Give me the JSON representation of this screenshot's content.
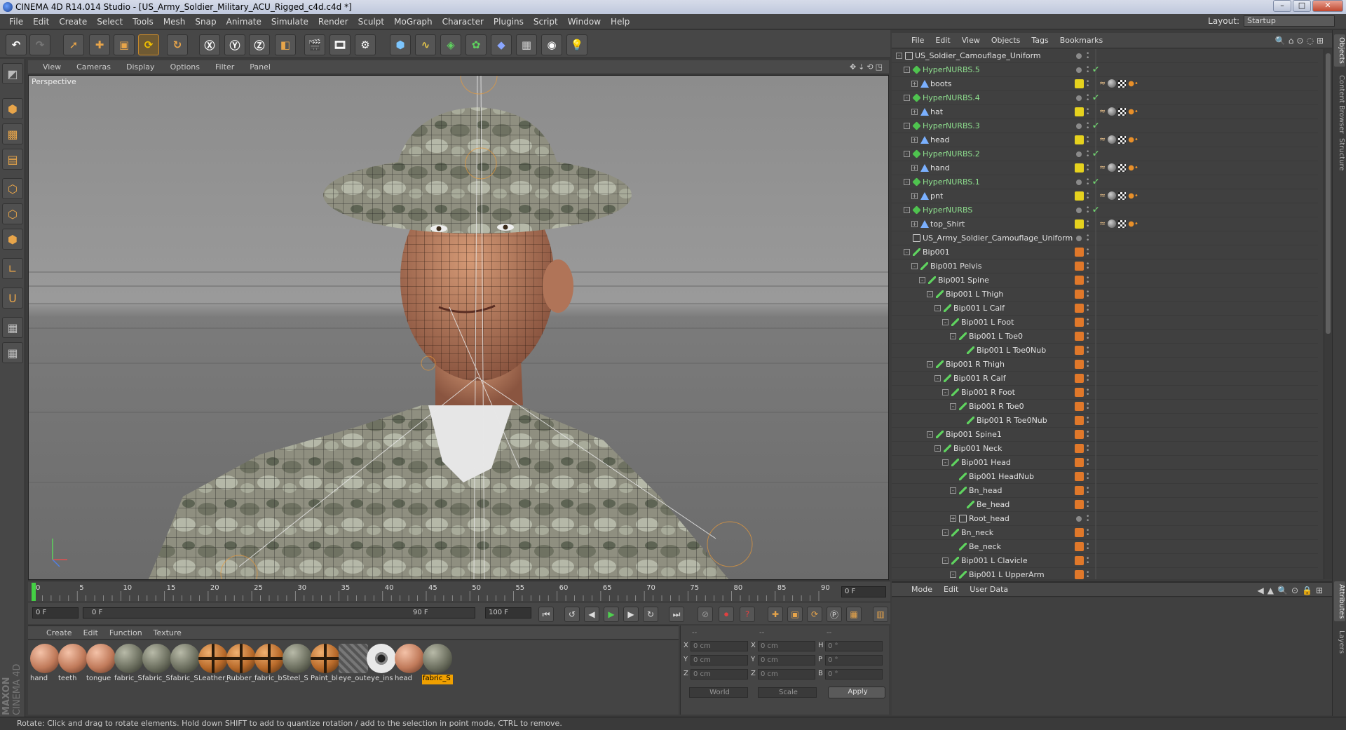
{
  "window": {
    "title": "CINEMA 4D R14.014 Studio - [US_Army_Soldier_Military_ACU_Rigged_c4d.c4d *]"
  },
  "menubar": {
    "items": [
      "File",
      "Edit",
      "Create",
      "Select",
      "Tools",
      "Mesh",
      "Snap",
      "Animate",
      "Simulate",
      "Render",
      "Sculpt",
      "MoGraph",
      "Character",
      "Plugins",
      "Script",
      "Window",
      "Help"
    ],
    "layout_label": "Layout:",
    "layout_value": "Startup"
  },
  "viewport": {
    "menu": [
      "View",
      "Cameras",
      "Display",
      "Options",
      "Filter",
      "Panel"
    ],
    "label": "Perspective"
  },
  "timeline": {
    "ticks": [
      "0",
      "5",
      "10",
      "15",
      "20",
      "25",
      "30",
      "35",
      "40",
      "45",
      "50",
      "55",
      "60",
      "65",
      "70",
      "75",
      "80",
      "85",
      "90"
    ],
    "current_frame": "0 F"
  },
  "transport": {
    "start_field": "0 F",
    "range_start": "0 F",
    "range_end": "90 F",
    "end_field": "100 F"
  },
  "material_manager": {
    "menu": [
      "Create",
      "Edit",
      "Function",
      "Texture"
    ],
    "materials": [
      {
        "label": "hand",
        "kind": "skin"
      },
      {
        "label": "teeth",
        "kind": "skin"
      },
      {
        "label": "tongue",
        "kind": "skin"
      },
      {
        "label": "fabric_S",
        "kind": "fabric"
      },
      {
        "label": "fabric_S",
        "kind": "fabric"
      },
      {
        "label": "fabric_S",
        "kind": "fabric"
      },
      {
        "label": "Leather_",
        "kind": "cross"
      },
      {
        "label": "Rubber_",
        "kind": "cross"
      },
      {
        "label": "fabric_b",
        "kind": "cross"
      },
      {
        "label": "Steel_S",
        "kind": "fabric"
      },
      {
        "label": "Paint_bl",
        "kind": "cross"
      },
      {
        "label": "eye_out",
        "kind": "striped"
      },
      {
        "label": "eye_ins",
        "kind": "eye"
      },
      {
        "label": "head",
        "kind": "skin"
      },
      {
        "label": "fabric_S",
        "kind": "fabric",
        "selected": true
      }
    ]
  },
  "coordinates": {
    "headers": [
      "--",
      "--",
      "--"
    ],
    "rows": [
      {
        "a": "X",
        "av": "0 cm",
        "b": "X",
        "bv": "0 cm",
        "c": "H",
        "cv": "0 °"
      },
      {
        "a": "Y",
        "av": "0 cm",
        "b": "Y",
        "bv": "0 cm",
        "c": "P",
        "cv": "0 °"
      },
      {
        "a": "Z",
        "av": "0 cm",
        "b": "Z",
        "bv": "0 cm",
        "c": "B",
        "cv": "0 °"
      }
    ],
    "world_label": "World",
    "scale_label": "Scale",
    "apply_label": "Apply"
  },
  "object_manager": {
    "menu": [
      "File",
      "Edit",
      "View",
      "Objects",
      "Tags",
      "Bookmarks"
    ],
    "objects": [
      {
        "name": "US_Soldier_Camouflage_Uniform",
        "level": 0,
        "type": "null",
        "exp": "-",
        "vis": "gray"
      },
      {
        "name": "HyperNURBS.5",
        "level": 1,
        "type": "nurbs",
        "exp": "-",
        "vis": "gray",
        "green": true,
        "chk": true
      },
      {
        "name": "boots",
        "level": 2,
        "type": "poly",
        "exp": "+",
        "vis": "yellow",
        "tags": true
      },
      {
        "name": "HyperNURBS.4",
        "level": 1,
        "type": "nurbs",
        "exp": "-",
        "vis": "gray",
        "green": true,
        "chk": true
      },
      {
        "name": "hat",
        "level": 2,
        "type": "poly",
        "exp": "+",
        "vis": "yellow",
        "tags": true
      },
      {
        "name": "HyperNURBS.3",
        "level": 1,
        "type": "nurbs",
        "exp": "-",
        "vis": "gray",
        "green": true,
        "chk": true
      },
      {
        "name": "head",
        "level": 2,
        "type": "poly",
        "exp": "+",
        "vis": "yellow",
        "tags": true
      },
      {
        "name": "HyperNURBS.2",
        "level": 1,
        "type": "nurbs",
        "exp": "-",
        "vis": "gray",
        "green": true,
        "chk": true
      },
      {
        "name": "hand",
        "level": 2,
        "type": "poly",
        "exp": "+",
        "vis": "yellow",
        "tags": true
      },
      {
        "name": "HyperNURBS.1",
        "level": 1,
        "type": "nurbs",
        "exp": "-",
        "vis": "gray",
        "green": true,
        "chk": true
      },
      {
        "name": "pnt",
        "level": 2,
        "type": "poly",
        "exp": "+",
        "vis": "yellow",
        "tags": true
      },
      {
        "name": "HyperNURBS",
        "level": 1,
        "type": "nurbs",
        "exp": "-",
        "vis": "gray",
        "green": true,
        "chk": true
      },
      {
        "name": "top_Shirt",
        "level": 2,
        "type": "poly",
        "exp": "+",
        "vis": "yellow",
        "tags": true
      },
      {
        "name": "US_Army_Soldier_Camouflage_Uniform",
        "level": 1,
        "type": "null",
        "exp": "",
        "vis": "gray"
      },
      {
        "name": "Bip001",
        "level": 1,
        "type": "bone",
        "exp": "-",
        "vis": "orange"
      },
      {
        "name": "Bip001 Pelvis",
        "level": 2,
        "type": "bone",
        "exp": "-",
        "vis": "orange"
      },
      {
        "name": "Bip001 Spine",
        "level": 3,
        "type": "bone",
        "exp": "-",
        "vis": "orange"
      },
      {
        "name": "Bip001 L Thigh",
        "level": 4,
        "type": "bone",
        "exp": "-",
        "vis": "orange"
      },
      {
        "name": "Bip001 L Calf",
        "level": 5,
        "type": "bone",
        "exp": "-",
        "vis": "orange"
      },
      {
        "name": "Bip001 L Foot",
        "level": 6,
        "type": "bone",
        "exp": "-",
        "vis": "orange"
      },
      {
        "name": "Bip001 L Toe0",
        "level": 7,
        "type": "bone",
        "exp": "-",
        "vis": "orange"
      },
      {
        "name": "Bip001 L Toe0Nub",
        "level": 8,
        "type": "bone",
        "exp": "",
        "vis": "orange"
      },
      {
        "name": "Bip001 R Thigh",
        "level": 4,
        "type": "bone",
        "exp": "-",
        "vis": "orange"
      },
      {
        "name": "Bip001 R Calf",
        "level": 5,
        "type": "bone",
        "exp": "-",
        "vis": "orange"
      },
      {
        "name": "Bip001 R Foot",
        "level": 6,
        "type": "bone",
        "exp": "-",
        "vis": "orange"
      },
      {
        "name": "Bip001 R Toe0",
        "level": 7,
        "type": "bone",
        "exp": "-",
        "vis": "orange"
      },
      {
        "name": "Bip001 R Toe0Nub",
        "level": 8,
        "type": "bone",
        "exp": "",
        "vis": "orange"
      },
      {
        "name": "Bip001 Spine1",
        "level": 4,
        "type": "bone",
        "exp": "-",
        "vis": "orange"
      },
      {
        "name": "Bip001 Neck",
        "level": 5,
        "type": "bone",
        "exp": "-",
        "vis": "orange"
      },
      {
        "name": "Bip001 Head",
        "level": 6,
        "type": "bone",
        "exp": "-",
        "vis": "orange"
      },
      {
        "name": "Bip001 HeadNub",
        "level": 7,
        "type": "bone",
        "exp": "",
        "vis": "orange"
      },
      {
        "name": "Bn_head",
        "level": 7,
        "type": "bone",
        "exp": "-",
        "vis": "orange"
      },
      {
        "name": "Be_head",
        "level": 8,
        "type": "bone",
        "exp": "",
        "vis": "orange"
      },
      {
        "name": "Root_head",
        "level": 7,
        "type": "null",
        "exp": "+",
        "vis": "gray"
      },
      {
        "name": "Bn_neck",
        "level": 6,
        "type": "bone",
        "exp": "-",
        "vis": "orange"
      },
      {
        "name": "Be_neck",
        "level": 7,
        "type": "bone",
        "exp": "",
        "vis": "orange"
      },
      {
        "name": "Bip001 L Clavicle",
        "level": 6,
        "type": "bone",
        "exp": "-",
        "vis": "orange"
      },
      {
        "name": "Bip001 L UpperArm",
        "level": 7,
        "type": "bone",
        "exp": "-",
        "vis": "orange"
      }
    ]
  },
  "attribute_manager": {
    "menu": [
      "Mode",
      "Edit",
      "User Data"
    ]
  },
  "side_tabs": [
    "Objects",
    "Content Browser",
    "Structure"
  ],
  "side_tabs_lower": [
    "Attributes",
    "Layers"
  ],
  "status": {
    "text": "Rotate: Click and drag to rotate elements. Hold down SHIFT to add to quantize rotation / add to the selection in point mode, CTRL to remove."
  },
  "brand": {
    "line1": "MAXON",
    "line2": "CINEMA 4D"
  },
  "colors": {
    "accent": "#f0a000",
    "vis_yellow": "#e6d21e",
    "vis_orange": "#e0782a",
    "nurbs_green": "#8fe08f"
  }
}
